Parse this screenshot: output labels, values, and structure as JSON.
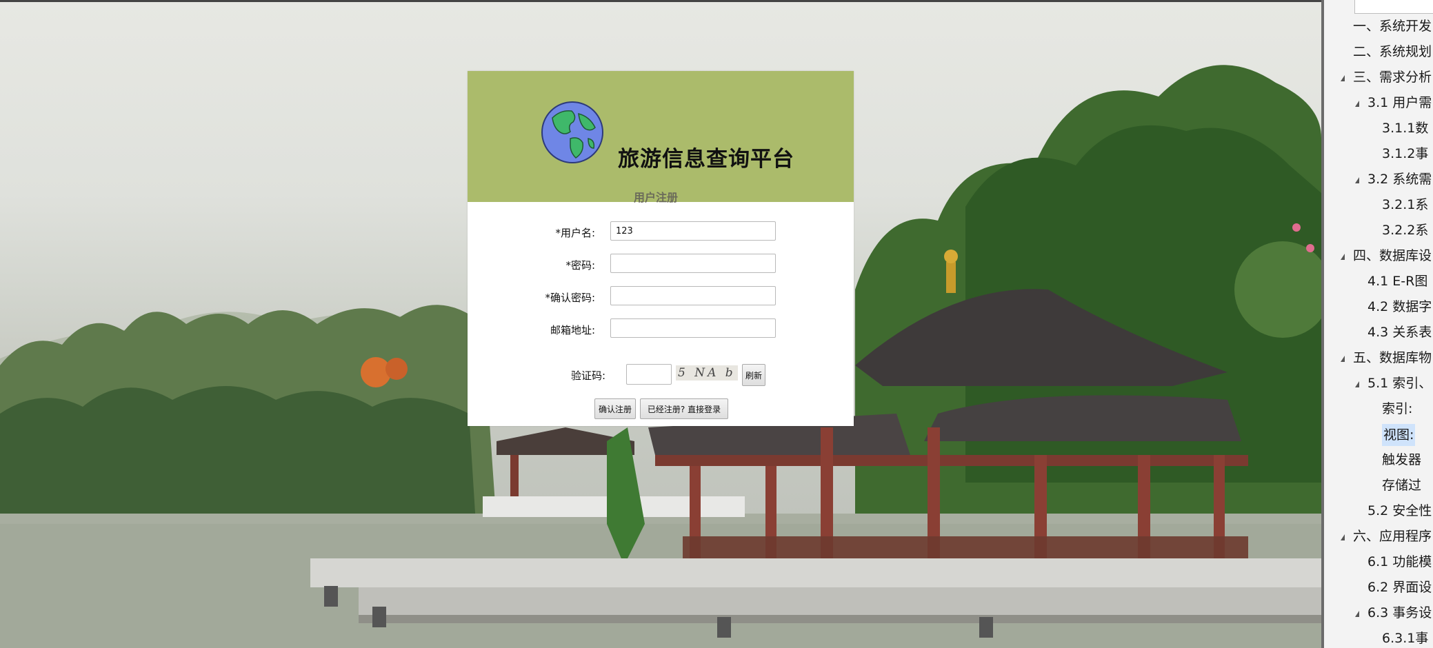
{
  "site": {
    "title": "旅游信息查询平台",
    "form_title": "用户注册"
  },
  "form": {
    "username_label": "*用户名:",
    "username_value": "123",
    "password_label": "*密码:",
    "password_value": "",
    "confirm_label": "*确认密码:",
    "confirm_value": "",
    "email_label": "邮箱地址:",
    "email_value": "",
    "captcha_label": "验证码:",
    "captcha_value": "",
    "captcha_text": "5 NA b",
    "refresh_label": "刷新",
    "submit_label": "确认注册",
    "login_label": "已经注册? 直接登录"
  },
  "nav": {
    "items": [
      {
        "label": "一、系统开发",
        "expandable": false,
        "selected": false
      },
      {
        "label": "二、系统规划",
        "expandable": false,
        "selected": false
      },
      {
        "label": "三、需求分析",
        "expandable": true,
        "selected": false
      },
      {
        "label": "3.1 用户需",
        "expandable": true,
        "selected": false
      },
      {
        "label": "3.1.1数",
        "expandable": false,
        "selected": false
      },
      {
        "label": "3.1.2事",
        "expandable": false,
        "selected": false
      },
      {
        "label": "3.2 系统需",
        "expandable": true,
        "selected": false
      },
      {
        "label": "3.2.1系",
        "expandable": false,
        "selected": false
      },
      {
        "label": "3.2.2系",
        "expandable": false,
        "selected": false
      },
      {
        "label": "四、数据库设",
        "expandable": true,
        "selected": false
      },
      {
        "label": "4.1 E-R图",
        "expandable": false,
        "selected": false
      },
      {
        "label": "4.2 数据字",
        "expandable": false,
        "selected": false
      },
      {
        "label": "4.3 关系表",
        "expandable": false,
        "selected": false
      },
      {
        "label": "五、数据库物",
        "expandable": true,
        "selected": false
      },
      {
        "label": "5.1 索引、",
        "expandable": true,
        "selected": false
      },
      {
        "label": "索引:",
        "expandable": false,
        "selected": false
      },
      {
        "label": "视图:",
        "expandable": false,
        "selected": true
      },
      {
        "label": "触发器",
        "expandable": false,
        "selected": false
      },
      {
        "label": "存储过",
        "expandable": false,
        "selected": false
      },
      {
        "label": "5.2 安全性",
        "expandable": false,
        "selected": false
      },
      {
        "label": "六、应用程序",
        "expandable": true,
        "selected": false
      },
      {
        "label": "6.1 功能模",
        "expandable": false,
        "selected": false
      },
      {
        "label": "6.2 界面设",
        "expandable": false,
        "selected": false
      },
      {
        "label": "6.3 事务设",
        "expandable": true,
        "selected": false
      },
      {
        "label": "6.3.1事",
        "expandable": false,
        "selected": false
      }
    ]
  },
  "colors": {
    "header_bg": "#abbb6b",
    "panel_bg": "#ffffff",
    "nav_bg": "#f3f3f3",
    "nav_selected": "#cfe3fb"
  },
  "icons": {
    "logo": "globe-icon",
    "nav_expand": "triangle-expand-icon"
  }
}
